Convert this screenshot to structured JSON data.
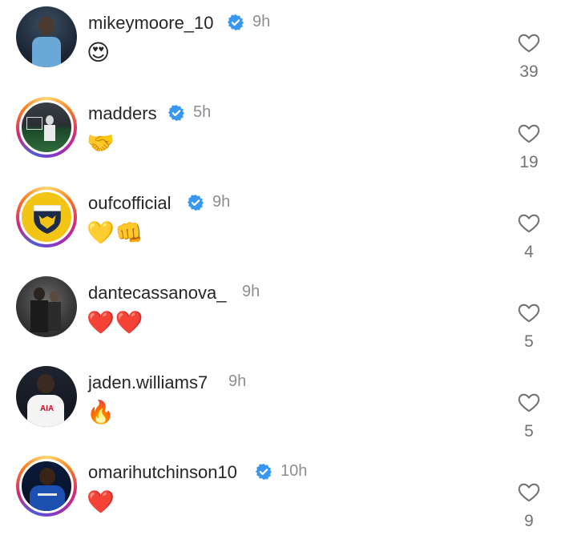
{
  "comments": [
    {
      "username": "mikeymoore_10",
      "verified": true,
      "time": "9h",
      "text": "😍",
      "likes": "39",
      "avatar_style": "dark-blue",
      "ring": false
    },
    {
      "username": "madders",
      "verified": true,
      "time": "5h",
      "text": "🤝",
      "likes": "19",
      "avatar_style": "stadium",
      "ring": true
    },
    {
      "username": "oufcofficial",
      "verified": true,
      "time": "9h",
      "text": "💛👊",
      "likes": "4",
      "avatar_style": "crest",
      "ring": true
    },
    {
      "username": "dantecassanova_",
      "verified": false,
      "time": "9h",
      "text": "❤️❤️",
      "likes": "5",
      "avatar_style": "night",
      "ring": false
    },
    {
      "username": "jaden.williams7",
      "verified": false,
      "time": "9h",
      "text": "🔥",
      "likes": "5",
      "avatar_style": "white-kit",
      "ring": false
    },
    {
      "username": "omarihutchinson10",
      "verified": true,
      "time": "10h",
      "text": "❤️",
      "likes": "9",
      "avatar_style": "blue-kit",
      "ring": true
    }
  ],
  "colors": {
    "verified": "#3897f0",
    "time": "#8e8e8e",
    "like_outline": "#737373"
  },
  "icons": {
    "like": "heart-outline-icon",
    "verified": "verified-badge-icon"
  }
}
